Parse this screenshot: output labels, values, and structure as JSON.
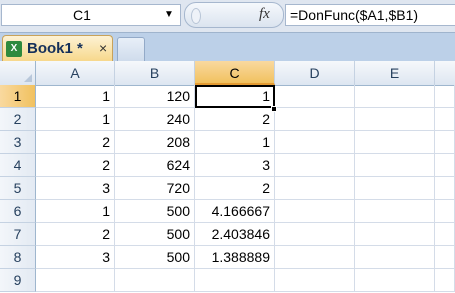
{
  "formula_bar": {
    "name_box": "C1",
    "name_box_arrow": "▼",
    "fx_label": "fx",
    "formula": "=DonFunc($A1,$B1)"
  },
  "tabs": {
    "workbook_tab": "Book1 *",
    "close_glyph": "×"
  },
  "sheet": {
    "columns": [
      "A",
      "B",
      "C",
      "D",
      "E"
    ],
    "selected_column": "C",
    "active_cell": "C1",
    "rows": [
      {
        "n": "1",
        "a": "1",
        "b": "120",
        "c": "1"
      },
      {
        "n": "2",
        "a": "1",
        "b": "240",
        "c": "2"
      },
      {
        "n": "3",
        "a": "2",
        "b": "208",
        "c": "1"
      },
      {
        "n": "4",
        "a": "2",
        "b": "624",
        "c": "3"
      },
      {
        "n": "5",
        "a": "3",
        "b": "720",
        "c": "2"
      },
      {
        "n": "6",
        "a": "1",
        "b": "500",
        "c": "4.166667"
      },
      {
        "n": "7",
        "a": "2",
        "b": "500",
        "c": "2.403846"
      },
      {
        "n": "8",
        "a": "3",
        "b": "500",
        "c": "1.388889"
      },
      {
        "n": "9",
        "a": "",
        "b": "",
        "c": ""
      }
    ]
  },
  "colors": {
    "selection_header": "#f1c15f",
    "header_bg": "#dde6f1",
    "tab_active": "#f7d88c"
  }
}
